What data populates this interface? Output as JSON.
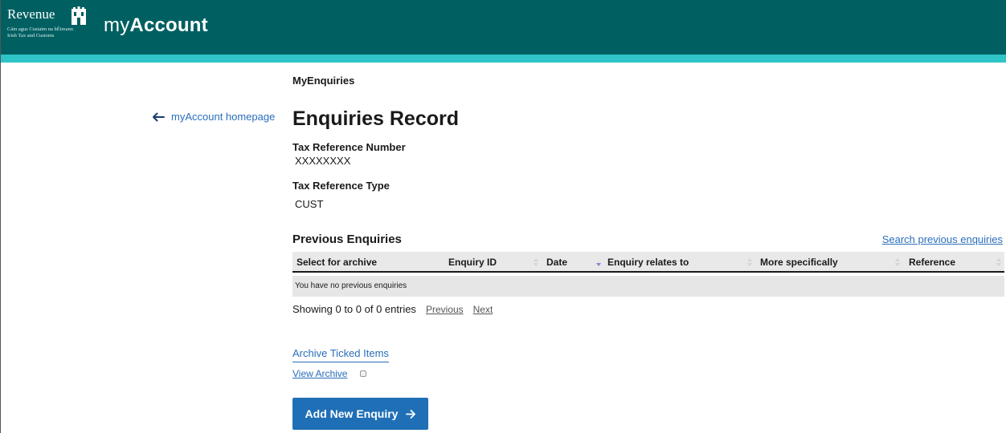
{
  "header": {
    "logo_word": "Revenue",
    "logo_sub1": "Cáin agus Custaim na hÉireann",
    "logo_sub2": "Irish Tax and Customs",
    "logo_icon": "harp-icon",
    "app_title_light": "my",
    "app_title_bold": "Account"
  },
  "colors": {
    "header_bg": "#005f61",
    "accent_strip": "#2ec4c8",
    "link": "#2a6ebb",
    "button": "#1f6fb6"
  },
  "nav": {
    "back_link": "myAccount homepage",
    "back_icon": "arrow-left-icon"
  },
  "main": {
    "breadcrumb": "MyEnquiries",
    "title": "Enquiries Record",
    "tax_ref_label": "Tax Reference Number",
    "tax_ref_value": "XXXXXXXX",
    "tax_type_label": "Tax Reference Type",
    "tax_type_value": "CUST"
  },
  "enquiries": {
    "section_title": "Previous Enquiries",
    "search_link": "Search previous enquiries",
    "columns": [
      "Select for archive",
      "Enquiry ID",
      "Date",
      "Enquiry relates to",
      "More specifically",
      "Reference"
    ],
    "sorted_column": "Date",
    "empty_message": "You have no previous enquiries",
    "pager_info": "Showing 0 to 0 of 0 entries",
    "pager_previous": "Previous",
    "pager_next": "Next"
  },
  "actions": {
    "archive_ticked": "Archive Ticked Items",
    "view_archive": "View Archive",
    "add_new": "Add New Enquiry",
    "add_icon": "arrow-right-icon"
  }
}
